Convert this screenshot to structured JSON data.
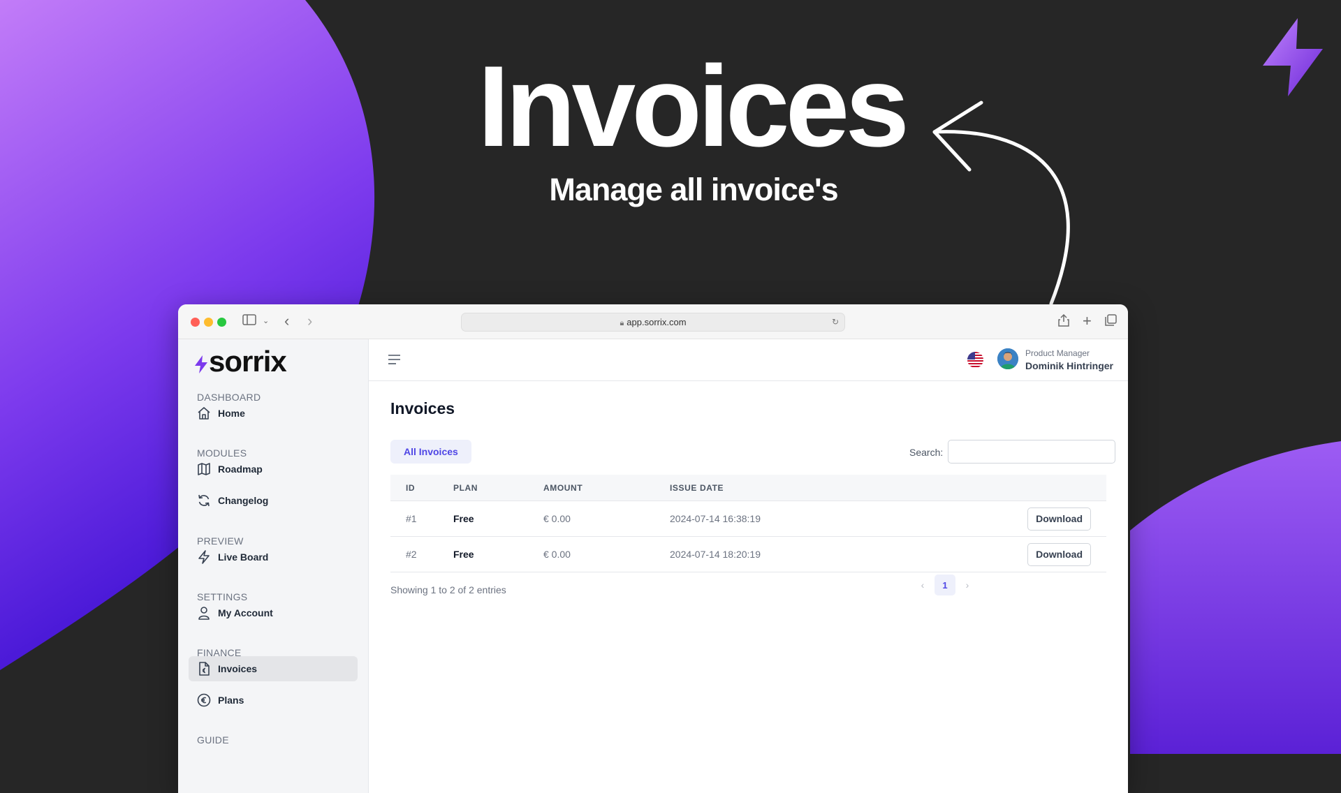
{
  "hero": {
    "title": "Invoices",
    "subtitle": "Manage all invoice's"
  },
  "colors": {
    "accent": "#4f46e5",
    "brand_purple": "#8b5cf6",
    "background": "#262626"
  },
  "browser": {
    "url": "app.sorrix.com"
  },
  "sidebar": {
    "logo": "sorrix",
    "sections": [
      {
        "label": "DASHBOARD",
        "items": [
          {
            "label": "Home",
            "icon": "home-icon"
          }
        ]
      },
      {
        "label": "MODULES",
        "items": [
          {
            "label": "Roadmap",
            "icon": "map-icon"
          },
          {
            "label": "Changelog",
            "icon": "refresh-icon"
          }
        ]
      },
      {
        "label": "PREVIEW",
        "items": [
          {
            "label": "Live Board",
            "icon": "bolt-icon"
          }
        ]
      },
      {
        "label": "SETTINGS",
        "items": [
          {
            "label": "My Account",
            "icon": "user-icon"
          }
        ]
      },
      {
        "label": "FINANCE",
        "items": [
          {
            "label": "Invoices",
            "icon": "invoice-icon",
            "active": true
          },
          {
            "label": "Plans",
            "icon": "euro-icon"
          }
        ]
      },
      {
        "label": "GUIDE",
        "items": []
      }
    ]
  },
  "user": {
    "role": "Product Manager",
    "name": "Dominik Hintringer"
  },
  "main": {
    "title": "Invoices",
    "tab": "All Invoices",
    "search_label": "Search:",
    "table": {
      "headers": [
        "ID",
        "PLAN",
        "AMOUNT",
        "ISSUE DATE"
      ],
      "rows": [
        {
          "id": "#1",
          "plan": "Free",
          "amount": "€ 0.00",
          "date": "2024-07-14 16:38:19",
          "action": "Download"
        },
        {
          "id": "#2",
          "plan": "Free",
          "amount": "€ 0.00",
          "date": "2024-07-14 18:20:19",
          "action": "Download"
        }
      ]
    },
    "showing": "Showing 1 to 2 of 2 entries",
    "pagination": {
      "prev": "‹",
      "current": "1",
      "next": "›"
    }
  }
}
